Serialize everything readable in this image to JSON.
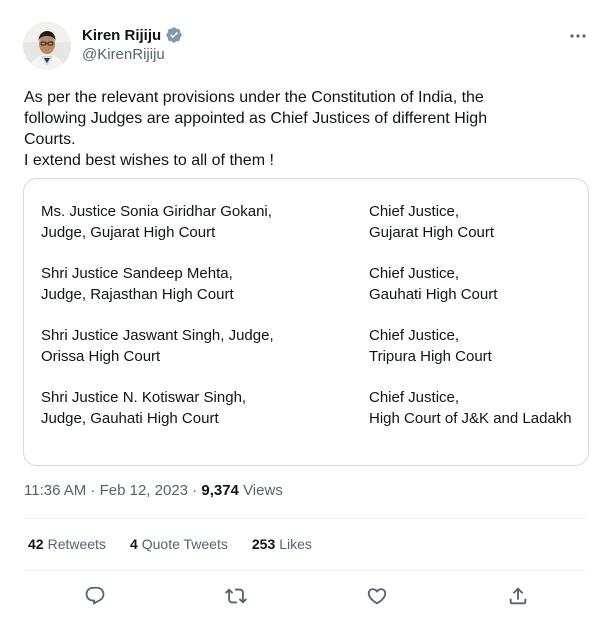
{
  "author": {
    "display_name": "Kiren Rijiju",
    "handle": "@KirenRijiju",
    "verified_icon": "verified-badge-icon",
    "avatar": "avatar"
  },
  "tweet": {
    "text_lines": [
      "As per the relevant provisions under the Constitution of India, the",
      "following Judges are appointed as Chief Justices of different High",
      "Courts.",
      "I extend best wishes to all of them !"
    ]
  },
  "card": {
    "rows": [
      {
        "judge": [
          "Ms. Justice Sonia Giridhar Gokani,",
          "Judge, Gujarat High Court"
        ],
        "post": [
          "Chief Justice,",
          "Gujarat High Court"
        ]
      },
      {
        "judge": [
          "Shri Justice Sandeep Mehta,",
          "Judge, Rajasthan High Court"
        ],
        "post": [
          "Chief Justice,",
          "Gauhati High Court"
        ]
      },
      {
        "judge": [
          "Shri Justice Jaswant Singh, Judge,",
          "Orissa High Court"
        ],
        "post": [
          "Chief Justice,",
          "Tripura High Court"
        ]
      },
      {
        "judge": [
          "Shri Justice N. Kotiswar Singh,",
          "Judge, Gauhati High Court"
        ],
        "post": [
          "Chief Justice,",
          "High Court of J&K and Ladakh"
        ]
      }
    ]
  },
  "meta": {
    "time": "11:36 AM",
    "separator": " · ",
    "date": "Feb 12, 2023",
    "views_count": "9,374",
    "views_label": "Views"
  },
  "stats": {
    "retweets_count": "42",
    "retweets_label": "Retweets",
    "quotes_count": "4",
    "quotes_label": "Quote Tweets",
    "likes_count": "253",
    "likes_label": "Likes"
  },
  "icons": {
    "more": "more-icon",
    "reply": "reply-icon",
    "retweet": "retweet-icon",
    "like": "like-icon",
    "share": "share-icon"
  },
  "colors": {
    "verified": "#829aab",
    "secondary_text": "#536471",
    "border": "#cfd9de",
    "divider": "#eff3f4",
    "icon": "#536471"
  }
}
